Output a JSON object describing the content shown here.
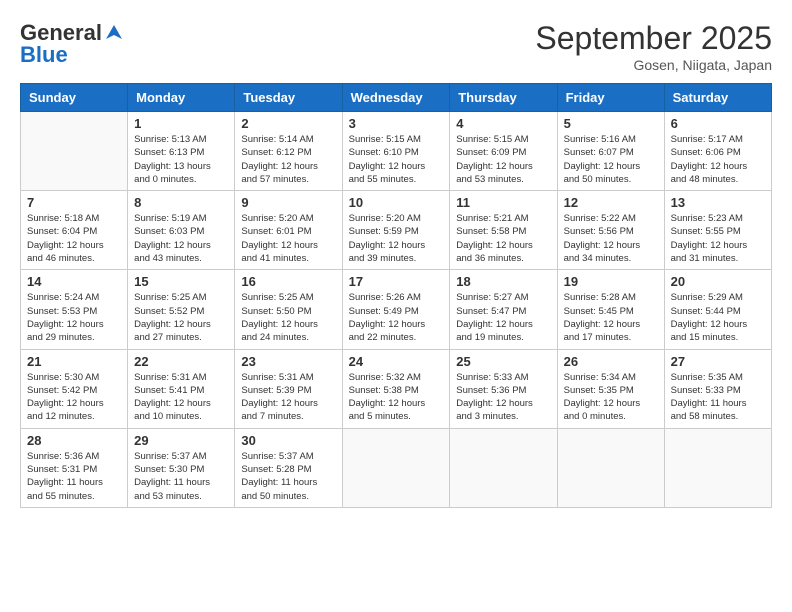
{
  "header": {
    "logo_general": "General",
    "logo_blue": "Blue",
    "title": "September 2025",
    "subtitle": "Gosen, Niigata, Japan"
  },
  "columns": [
    "Sunday",
    "Monday",
    "Tuesday",
    "Wednesday",
    "Thursday",
    "Friday",
    "Saturday"
  ],
  "weeks": [
    [
      {
        "day": "",
        "info": ""
      },
      {
        "day": "1",
        "info": "Sunrise: 5:13 AM\nSunset: 6:13 PM\nDaylight: 13 hours\nand 0 minutes."
      },
      {
        "day": "2",
        "info": "Sunrise: 5:14 AM\nSunset: 6:12 PM\nDaylight: 12 hours\nand 57 minutes."
      },
      {
        "day": "3",
        "info": "Sunrise: 5:15 AM\nSunset: 6:10 PM\nDaylight: 12 hours\nand 55 minutes."
      },
      {
        "day": "4",
        "info": "Sunrise: 5:15 AM\nSunset: 6:09 PM\nDaylight: 12 hours\nand 53 minutes."
      },
      {
        "day": "5",
        "info": "Sunrise: 5:16 AM\nSunset: 6:07 PM\nDaylight: 12 hours\nand 50 minutes."
      },
      {
        "day": "6",
        "info": "Sunrise: 5:17 AM\nSunset: 6:06 PM\nDaylight: 12 hours\nand 48 minutes."
      }
    ],
    [
      {
        "day": "7",
        "info": "Sunrise: 5:18 AM\nSunset: 6:04 PM\nDaylight: 12 hours\nand 46 minutes."
      },
      {
        "day": "8",
        "info": "Sunrise: 5:19 AM\nSunset: 6:03 PM\nDaylight: 12 hours\nand 43 minutes."
      },
      {
        "day": "9",
        "info": "Sunrise: 5:20 AM\nSunset: 6:01 PM\nDaylight: 12 hours\nand 41 minutes."
      },
      {
        "day": "10",
        "info": "Sunrise: 5:20 AM\nSunset: 5:59 PM\nDaylight: 12 hours\nand 39 minutes."
      },
      {
        "day": "11",
        "info": "Sunrise: 5:21 AM\nSunset: 5:58 PM\nDaylight: 12 hours\nand 36 minutes."
      },
      {
        "day": "12",
        "info": "Sunrise: 5:22 AM\nSunset: 5:56 PM\nDaylight: 12 hours\nand 34 minutes."
      },
      {
        "day": "13",
        "info": "Sunrise: 5:23 AM\nSunset: 5:55 PM\nDaylight: 12 hours\nand 31 minutes."
      }
    ],
    [
      {
        "day": "14",
        "info": "Sunrise: 5:24 AM\nSunset: 5:53 PM\nDaylight: 12 hours\nand 29 minutes."
      },
      {
        "day": "15",
        "info": "Sunrise: 5:25 AM\nSunset: 5:52 PM\nDaylight: 12 hours\nand 27 minutes."
      },
      {
        "day": "16",
        "info": "Sunrise: 5:25 AM\nSunset: 5:50 PM\nDaylight: 12 hours\nand 24 minutes."
      },
      {
        "day": "17",
        "info": "Sunrise: 5:26 AM\nSunset: 5:49 PM\nDaylight: 12 hours\nand 22 minutes."
      },
      {
        "day": "18",
        "info": "Sunrise: 5:27 AM\nSunset: 5:47 PM\nDaylight: 12 hours\nand 19 minutes."
      },
      {
        "day": "19",
        "info": "Sunrise: 5:28 AM\nSunset: 5:45 PM\nDaylight: 12 hours\nand 17 minutes."
      },
      {
        "day": "20",
        "info": "Sunrise: 5:29 AM\nSunset: 5:44 PM\nDaylight: 12 hours\nand 15 minutes."
      }
    ],
    [
      {
        "day": "21",
        "info": "Sunrise: 5:30 AM\nSunset: 5:42 PM\nDaylight: 12 hours\nand 12 minutes."
      },
      {
        "day": "22",
        "info": "Sunrise: 5:31 AM\nSunset: 5:41 PM\nDaylight: 12 hours\nand 10 minutes."
      },
      {
        "day": "23",
        "info": "Sunrise: 5:31 AM\nSunset: 5:39 PM\nDaylight: 12 hours\nand 7 minutes."
      },
      {
        "day": "24",
        "info": "Sunrise: 5:32 AM\nSunset: 5:38 PM\nDaylight: 12 hours\nand 5 minutes."
      },
      {
        "day": "25",
        "info": "Sunrise: 5:33 AM\nSunset: 5:36 PM\nDaylight: 12 hours\nand 3 minutes."
      },
      {
        "day": "26",
        "info": "Sunrise: 5:34 AM\nSunset: 5:35 PM\nDaylight: 12 hours\nand 0 minutes."
      },
      {
        "day": "27",
        "info": "Sunrise: 5:35 AM\nSunset: 5:33 PM\nDaylight: 11 hours\nand 58 minutes."
      }
    ],
    [
      {
        "day": "28",
        "info": "Sunrise: 5:36 AM\nSunset: 5:31 PM\nDaylight: 11 hours\nand 55 minutes."
      },
      {
        "day": "29",
        "info": "Sunrise: 5:37 AM\nSunset: 5:30 PM\nDaylight: 11 hours\nand 53 minutes."
      },
      {
        "day": "30",
        "info": "Sunrise: 5:37 AM\nSunset: 5:28 PM\nDaylight: 11 hours\nand 50 minutes."
      },
      {
        "day": "",
        "info": ""
      },
      {
        "day": "",
        "info": ""
      },
      {
        "day": "",
        "info": ""
      },
      {
        "day": "",
        "info": ""
      }
    ]
  ]
}
